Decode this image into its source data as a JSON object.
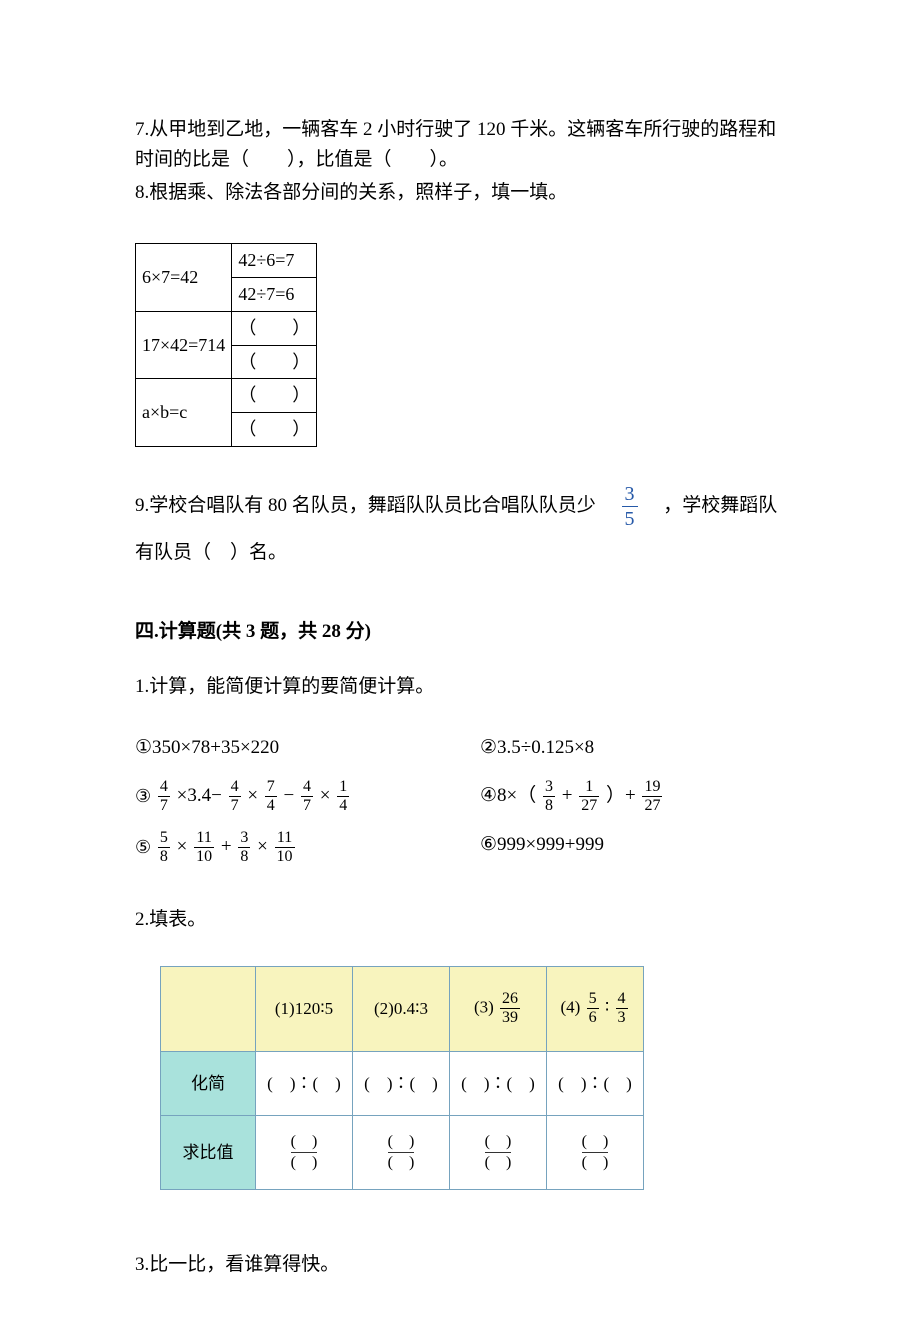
{
  "q7": "7.从甲地到乙地，一辆客车 2 小时行驶了 120 千米。这辆客车所行驶的路程和时间的比是（　　），比值是（　　）。",
  "q8_intro": "8.根据乘、除法各部分间的关系，照样子，填一填。",
  "table1": {
    "r1c1": "6×7=42",
    "r1c2a": "42÷6=7",
    "r1c2b": "42÷7=6",
    "r2c1": "17×42=714",
    "r2c2a": "（　　）",
    "r2c2b": "（　　）",
    "r3c1": "a×b=c",
    "r3c2a": "（　　）",
    "r3c2b": "（　　）"
  },
  "q9": {
    "pre": "9.学校合唱队有 80 名队员，舞蹈队队员比合唱队队员少　",
    "frac_num": "3",
    "frac_den": "5",
    "post": "　，学校舞蹈队",
    "line2": "有队员（　）名。"
  },
  "section4": "四.计算题(共 3 题，共 28 分)",
  "q4_1_intro": "1.计算，能简便计算的要简便计算。",
  "calc": {
    "c1": "①350×78+35×220",
    "c2": "②3.5÷0.125×8",
    "c3": {
      "lead": "③",
      "f1n": "4",
      "f1d": "7",
      "mid1": "×3.4−",
      "f2n": "4",
      "f2d": "7",
      "mid2": "×",
      "f3n": "7",
      "f3d": "4",
      "mid3": "−",
      "f4n": "4",
      "f4d": "7",
      "mid4": "×",
      "f5n": "1",
      "f5d": "4"
    },
    "c4": {
      "lead": "④8×（",
      "f1n": "3",
      "f1d": "8",
      "mid1": "+",
      "f2n": "1",
      "f2d": "27",
      "mid2": "）+",
      "f3n": "19",
      "f3d": "27"
    },
    "c5": {
      "lead": "⑤",
      "f1n": "5",
      "f1d": "8",
      "mid1": "×",
      "f2n": "11",
      "f2d": "10",
      "mid2": "+",
      "f3n": "3",
      "f3d": "8",
      "mid3": "×",
      "f4n": "11",
      "f4d": "10"
    },
    "c6": "⑥999×999+999"
  },
  "q4_2_intro": "2.填表。",
  "table2": {
    "h1": "(1)120∶5",
    "h2": "(2)0.4∶3",
    "h3_pre": "(3)",
    "h3_num": "26",
    "h3_den": "39",
    "h4_pre": "(4)",
    "h4_an": "5",
    "h4_ad": "6",
    "h4_mid": "∶",
    "h4_bn": "4",
    "h4_bd": "3",
    "row1_label": "化简",
    "row1_cell": "(　)∶(　)",
    "row2_label": "求比值",
    "row2_pn": "(　)",
    "row2_pd": "(　)"
  },
  "q4_3_intro": "3.比一比，看谁算得快。"
}
